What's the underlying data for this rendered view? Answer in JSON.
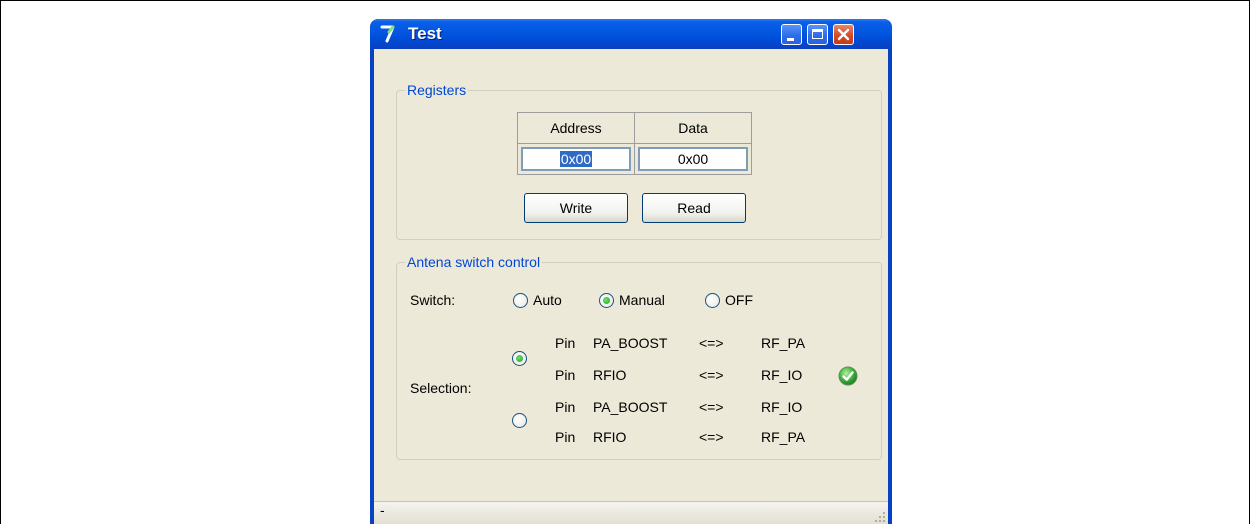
{
  "window": {
    "title": "Test",
    "controls": {
      "minimize": "minimize",
      "maximize": "maximize",
      "close": "close"
    }
  },
  "registers": {
    "legend": "Registers",
    "address_header": "Address",
    "data_header": "Data",
    "address_value": "0x00",
    "data_value": "0x00",
    "write_label": "Write",
    "read_label": "Read"
  },
  "antenna": {
    "legend": "Antena switch control",
    "switch_label": "Switch:",
    "switch_options": [
      {
        "label": "Auto",
        "selected": false
      },
      {
        "label": "Manual",
        "selected": true
      },
      {
        "label": "OFF",
        "selected": false
      }
    ],
    "selection_label": "Selection:",
    "selection_options": [
      {
        "selected": true,
        "rows": [
          {
            "pin": "Pin",
            "name": "PA_BOOST",
            "arrow": "<=>",
            "rf": "RF_PA"
          },
          {
            "pin": "Pin",
            "name": "RFIO",
            "arrow": "<=>",
            "rf": "RF_IO"
          }
        ]
      },
      {
        "selected": false,
        "rows": [
          {
            "pin": "Pin",
            "name": "PA_BOOST",
            "arrow": "<=>",
            "rf": "RF_IO"
          },
          {
            "pin": "Pin",
            "name": "RFIO",
            "arrow": "<=>",
            "rf": "RF_PA"
          }
        ]
      }
    ],
    "status_icon": "green-check-icon"
  },
  "statusbar": {
    "text": "-"
  },
  "colors": {
    "legend_text": "#0046d5",
    "titlebar": "#0256e0",
    "client_bg": "#ece9d8"
  }
}
